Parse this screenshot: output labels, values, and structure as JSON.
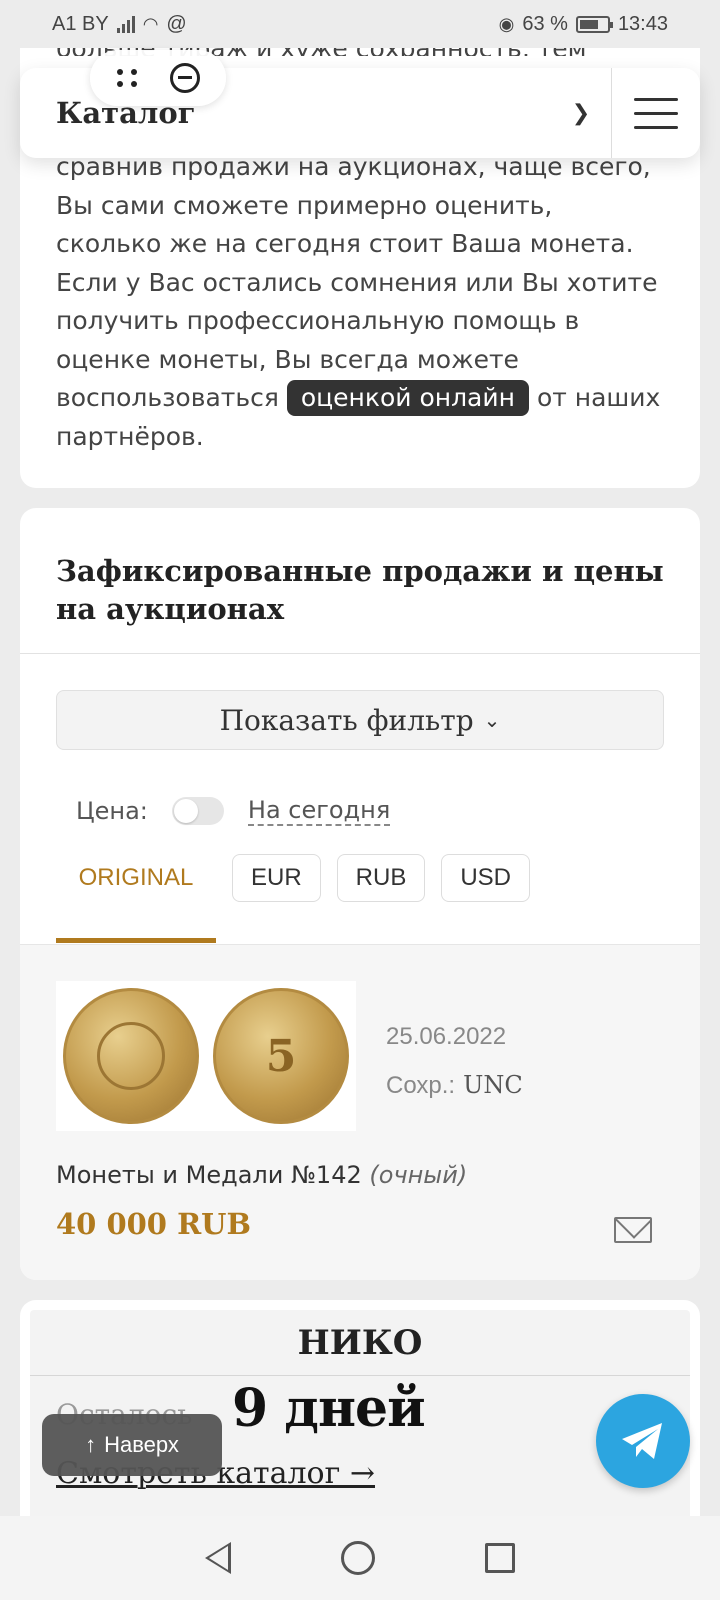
{
  "status_bar": {
    "carrier": "A1 BY",
    "battery_percent": "63 %",
    "time": "13:43"
  },
  "float_controls": {
    "drag_icon": "grid-dots-icon",
    "minimize_icon": "minus-circle-icon"
  },
  "header": {
    "title": "Каталог",
    "chevron_icon": "chevron-down-icon",
    "menu_icon": "hamburger-menu-icon"
  },
  "intro": {
    "cut_line": "больше тираж и хуже сохранность, тем",
    "text_before_link": "сравнив продажи на аукционах, чаще всего, Вы сами сможете примерно оценить, сколько же на сегодня стоит Ваша монета. Если у Вас остались сомнения или Вы хотите получить профессиональную помощь в оценке монеты, Вы всегда можете воспользоваться",
    "link_label": "оценкой онлайн",
    "text_after_link": "от наших партнёров."
  },
  "sales": {
    "title": "Зафиксированные продажи и цены на аукционах",
    "filter_button": "Показать фильтр",
    "price_label": "Цена:",
    "today_label": "На сегодня",
    "currency_tabs": [
      "ORIGINAL",
      "EUR",
      "RUB",
      "USD"
    ],
    "active_currency": "ORIGINAL",
    "lot": {
      "coin_reverse_text": "5",
      "date": "25.06.2022",
      "condition_label": "Сохр.:",
      "condition_value": "UNC",
      "auction": "Монеты и Медали №142",
      "auction_type": "(очный)",
      "price": "40 000 RUB",
      "mail_icon": "envelope-icon"
    }
  },
  "auction_promo": {
    "name": "НИКО",
    "remaining_label": "Осталось",
    "days": "9 дней",
    "link": "Смотреть каталог →"
  },
  "floating": {
    "to_top": "Наверх",
    "telegram_icon": "telegram-icon"
  },
  "nav_bar": {
    "back_icon": "back-triangle-icon",
    "home_icon": "home-circle-icon",
    "recent_icon": "recent-square-icon"
  },
  "colors": {
    "accent": "#b07a1e",
    "telegram": "#2ca5e0",
    "chip_bg": "#333333"
  }
}
